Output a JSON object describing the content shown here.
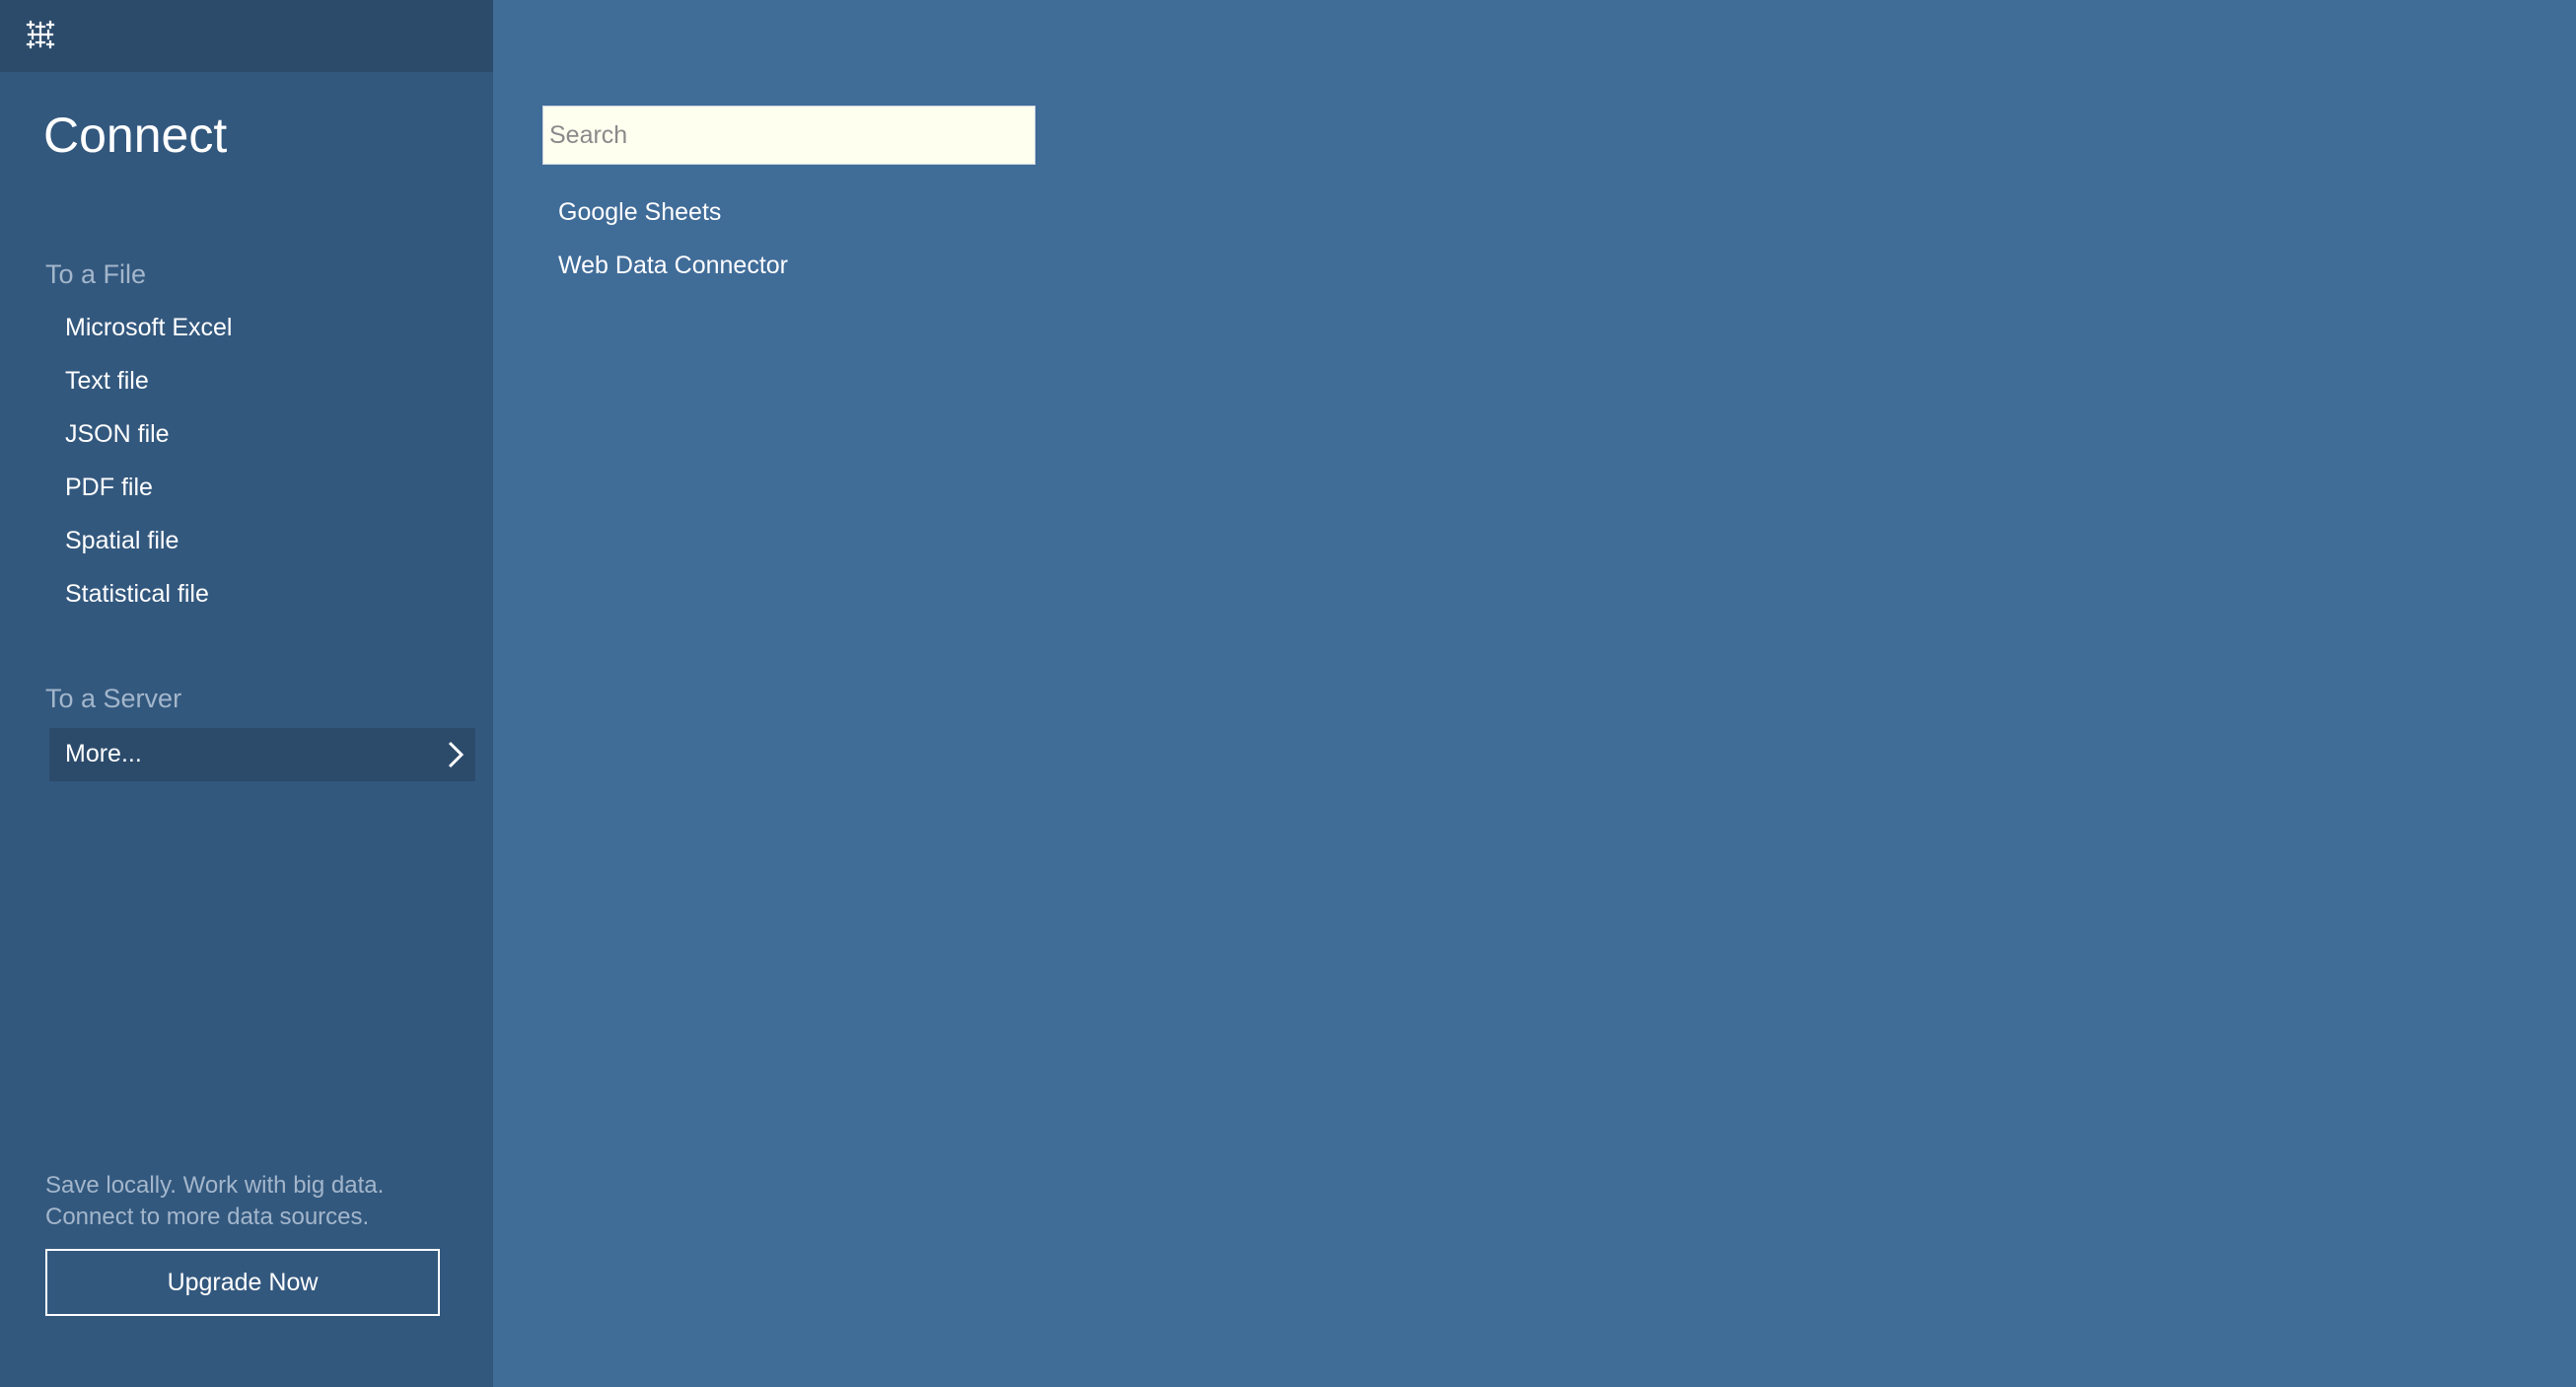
{
  "app": {
    "logo_icon": "tableau-logo-icon"
  },
  "sidebar": {
    "title": "Connect",
    "file_section": {
      "header": "To a File",
      "items": [
        {
          "label": "Microsoft Excel"
        },
        {
          "label": "Text file"
        },
        {
          "label": "JSON file"
        },
        {
          "label": "PDF file"
        },
        {
          "label": "Spatial file"
        },
        {
          "label": "Statistical file"
        }
      ]
    },
    "server_section": {
      "header": "To a Server",
      "more_label": "More...",
      "more_icon": "chevron-right-icon"
    },
    "promo": {
      "line1": "Save locally. Work with big data.",
      "line2": "Connect to more data sources.",
      "button_label": "Upgrade Now"
    }
  },
  "main": {
    "search": {
      "placeholder": "Search",
      "value": ""
    },
    "results": [
      {
        "label": "Google Sheets"
      },
      {
        "label": "Web Data Connector"
      }
    ]
  },
  "colors": {
    "main_background": "#406c98",
    "sidebar_background": "#33587e",
    "topbar_background": "#2c4b6b",
    "muted_text": "#a3b6cb",
    "search_background": "#fffff0"
  }
}
